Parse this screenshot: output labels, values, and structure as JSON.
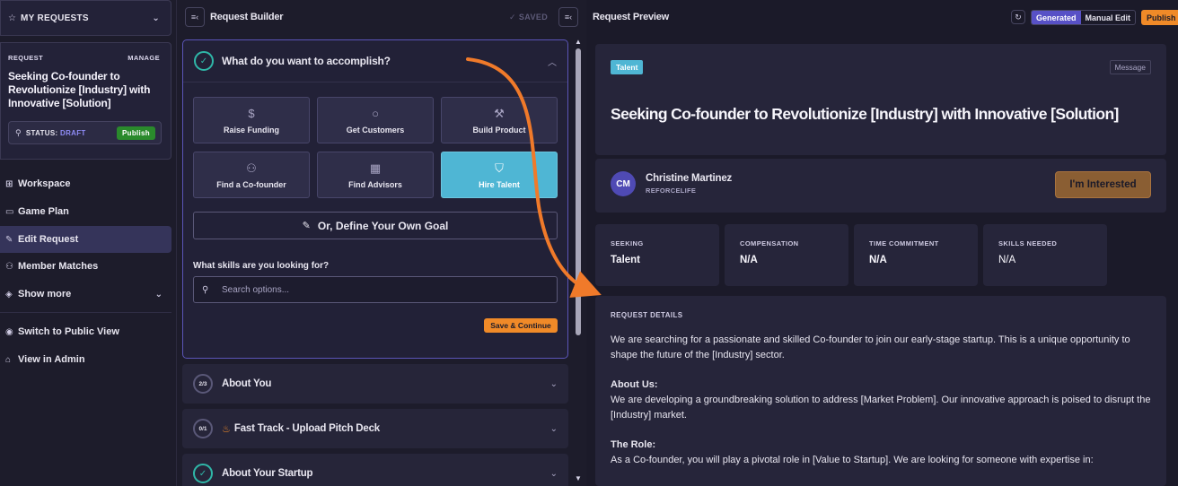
{
  "sidebar": {
    "my_requests": "MY REQUESTS",
    "request_label": "REQUEST",
    "manage_label": "MANAGE",
    "request_title": "Seeking Co-founder to Revolutionize [Industry] with Innovative [Solution]",
    "status_label": "STATUS:",
    "status_value": "DRAFT",
    "publish": "Publish",
    "nav": [
      {
        "label": "Workspace",
        "icon": "grid-icon"
      },
      {
        "label": "Game Plan",
        "icon": "book-icon"
      },
      {
        "label": "Edit Request",
        "icon": "edit-icon"
      },
      {
        "label": "Member Matches",
        "icon": "users-icon"
      },
      {
        "label": "Show more",
        "icon": "layers-icon"
      }
    ],
    "switch_public": "Switch to Public View",
    "view_admin": "View in Admin"
  },
  "builder": {
    "title": "Request Builder",
    "saved": "SAVED",
    "question": "What do you want to accomplish?",
    "goals": [
      {
        "label": "Raise Funding",
        "icon": "dollar-icon",
        "selected": false
      },
      {
        "label": "Get Customers",
        "icon": "search-icon",
        "selected": false
      },
      {
        "label": "Build Product",
        "icon": "hammer-icon",
        "selected": false
      },
      {
        "label": "Find a Co-founder",
        "icon": "users-icon",
        "selected": false
      },
      {
        "label": "Find Advisors",
        "icon": "building-icon",
        "selected": false
      },
      {
        "label": "Hire Talent",
        "icon": "handshake-icon",
        "selected": true
      }
    ],
    "own_goal": "Or, Define Your Own Goal",
    "skills_label": "What skills are you looking for?",
    "search_placeholder": "Search options...",
    "save_continue": "Save & Continue",
    "sections": [
      {
        "progress": "2/3",
        "label": "About You"
      },
      {
        "progress": "0/1",
        "label": "Fast Track - Upload Pitch Deck"
      },
      {
        "progress": "",
        "label": "About Your Startup"
      }
    ]
  },
  "preview": {
    "title": "Request Preview",
    "generated": "Generated",
    "manual_edit": "Manual Edit",
    "publish": "Publish",
    "tag": "Talent",
    "message": "Message",
    "headline": "Seeking Co-founder to Revolutionize [Industry] with Innovative [Solution]",
    "avatar_initials": "CM",
    "author_name": "Christine Martinez",
    "author_org": "REFORCELIFE",
    "interested": "I'm Interested",
    "stats": [
      {
        "key": "SEEKING",
        "value": "Talent"
      },
      {
        "key": "COMPENSATION",
        "value": "N/A"
      },
      {
        "key": "TIME COMMITMENT",
        "value": "N/A"
      },
      {
        "key": "SKILLS NEEDED",
        "value": "N/A"
      }
    ],
    "details_label": "REQUEST DETAILS",
    "details_intro": "We are searching for a passionate and skilled Co-founder to join our early-stage startup. This is a unique opportunity to shape the future of the [Industry] sector.",
    "about_us_label": "About Us:",
    "about_us": "We are developing a groundbreaking solution to address [Market Problem]. Our innovative approach is poised to disrupt the [Industry] market.",
    "role_label": "The Role:",
    "role": "As a Co-founder, you will play a pivotal role in [Value to Startup]. We are looking for someone with expertise in:"
  },
  "colors": {
    "accent": "#5851c6",
    "teal": "#4fb6d4",
    "orange": "#f08a28",
    "green": "#2a8a2c",
    "check": "#2fb7a8"
  }
}
